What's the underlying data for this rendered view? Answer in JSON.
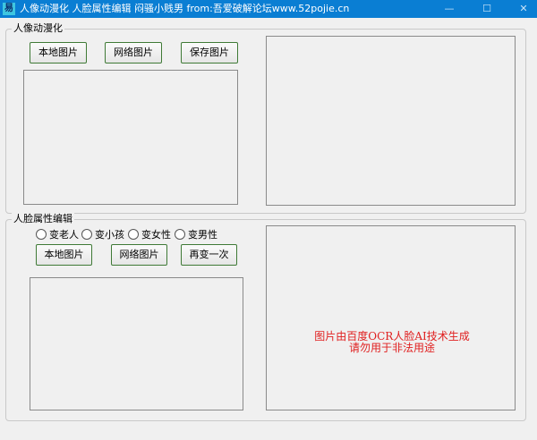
{
  "window": {
    "title": "人像动漫化 人脸属性编辑 闷骚小贱男 from:吾爱破解论坛www.52pojie.cn",
    "app_icon_glyph": "易",
    "minimize_glyph": "—",
    "maximize_glyph": "☐",
    "close_glyph": "✕"
  },
  "anime_group": {
    "title": "人像动漫化",
    "local_image_label": "本地图片",
    "web_image_label": "网络图片",
    "save_image_label": "保存图片"
  },
  "face_group": {
    "title": "人脸属性编辑",
    "options": [
      {
        "label": "变老人",
        "selected": false
      },
      {
        "label": "变小孩",
        "selected": false
      },
      {
        "label": "变女性",
        "selected": false
      },
      {
        "label": "变男性",
        "selected": false
      }
    ],
    "local_image_label": "本地图片",
    "web_image_label": "网络图片",
    "retry_label": "再变一次"
  },
  "notice": {
    "line1": "图片由百度OCR人脸AI技术生成",
    "line2": "请勿用于非法用途"
  },
  "colors": {
    "titlebar": "#0a7ed3",
    "button_border": "#3f7a36",
    "notice_text": "#e02020"
  }
}
